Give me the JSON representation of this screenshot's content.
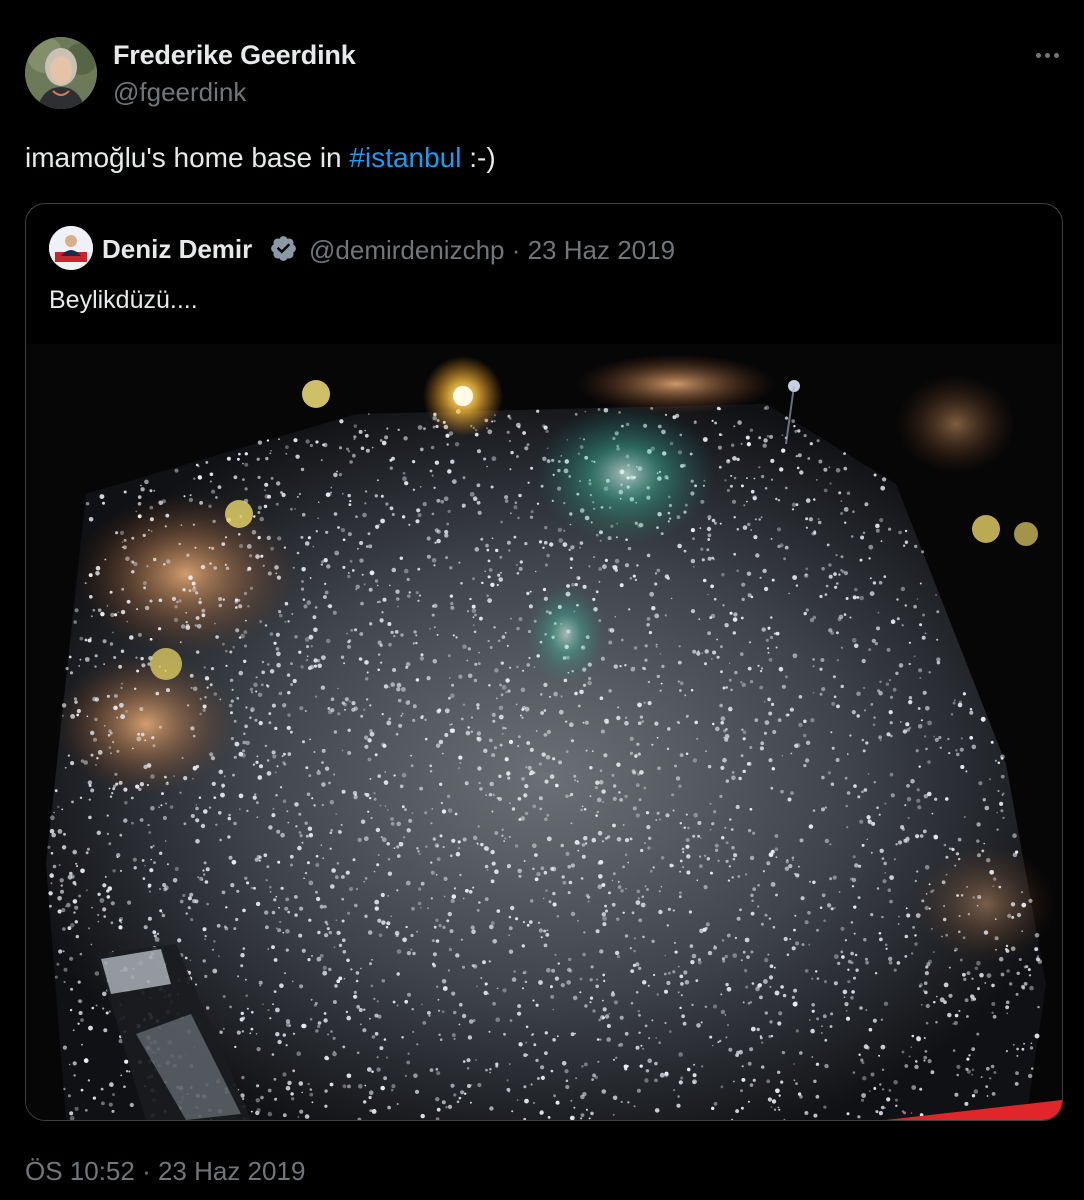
{
  "author": {
    "display_name": "Frederike Geerdink",
    "handle": "@fgeerdink"
  },
  "tweet": {
    "text_before": "imamoğlu's home base in ",
    "hashtag": "#istanbul",
    "text_after": " :-)",
    "timestamp": "ÖS 10:52 · 23 Haz 2019"
  },
  "quote": {
    "display_name": "Deniz Demir",
    "handle_and_date": "@demirdenizchp · 23 Haz 2019",
    "text": "Beylikdüzü....",
    "verified": true
  },
  "icons": {
    "more": "more-horizontal-icon",
    "verified": "verified-badge-icon"
  },
  "colors": {
    "background": "#000000",
    "primary_text": "#e7e9ea",
    "secondary_text": "#71767b",
    "link": "#1d9bf0",
    "card_border": "#3e4144",
    "verified_badge": "#8b98a5"
  }
}
